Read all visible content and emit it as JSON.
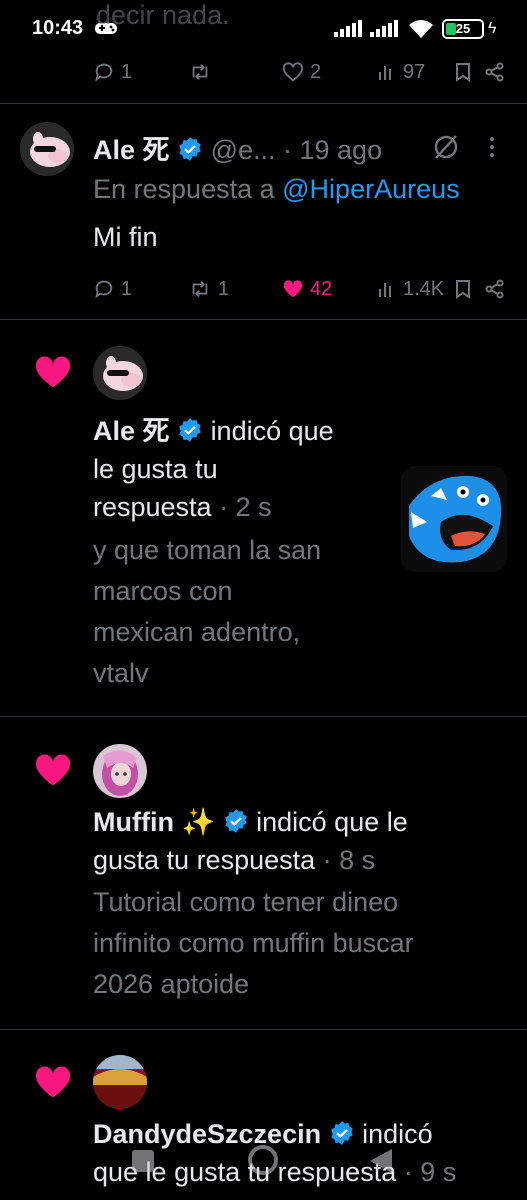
{
  "status_bar": {
    "time": "10:43",
    "battery": "25"
  },
  "prev_tweet": {
    "text_fragment": "decir nada.",
    "replies": "1",
    "likes": "2",
    "views": "97"
  },
  "tweet": {
    "display_name": "Ale 死",
    "handle": "@e...",
    "time": "· 19 ago",
    "reply_prefix": "En respuesta a",
    "reply_handle": "@HiperAureus",
    "body": "Mi fin",
    "replies": "1",
    "retweets": "1",
    "likes": "42",
    "views": "1.4K"
  },
  "notifications": [
    {
      "name": "Ale 死",
      "line1_rest": "indicó que",
      "line2": "le gusta tu",
      "line3": "respuesta",
      "time": "· 2 s",
      "sub": [
        "y que toman la san",
        "marcos con",
        "mexican adentro,",
        "vtalv"
      ]
    },
    {
      "name": "Muffin ✨",
      "line1_rest": "indicó que le",
      "line2": "gusta tu respuesta",
      "time": "· 8 s",
      "sub": [
        "Tutorial como tener dineo",
        "infinito como muffin buscar",
        "2026 aptoide"
      ]
    },
    {
      "name": "DandydeSzczecin",
      "line1_rest": "indicó",
      "line2": "que le gusta tu respuesta",
      "time": "· 9 s"
    }
  ],
  "colors": {
    "background": "#000000",
    "text": "#e7e9ea",
    "muted": "#71767b",
    "link": "#1d9bf0",
    "like_pink": "#f91880",
    "divider": "#2f3336"
  }
}
